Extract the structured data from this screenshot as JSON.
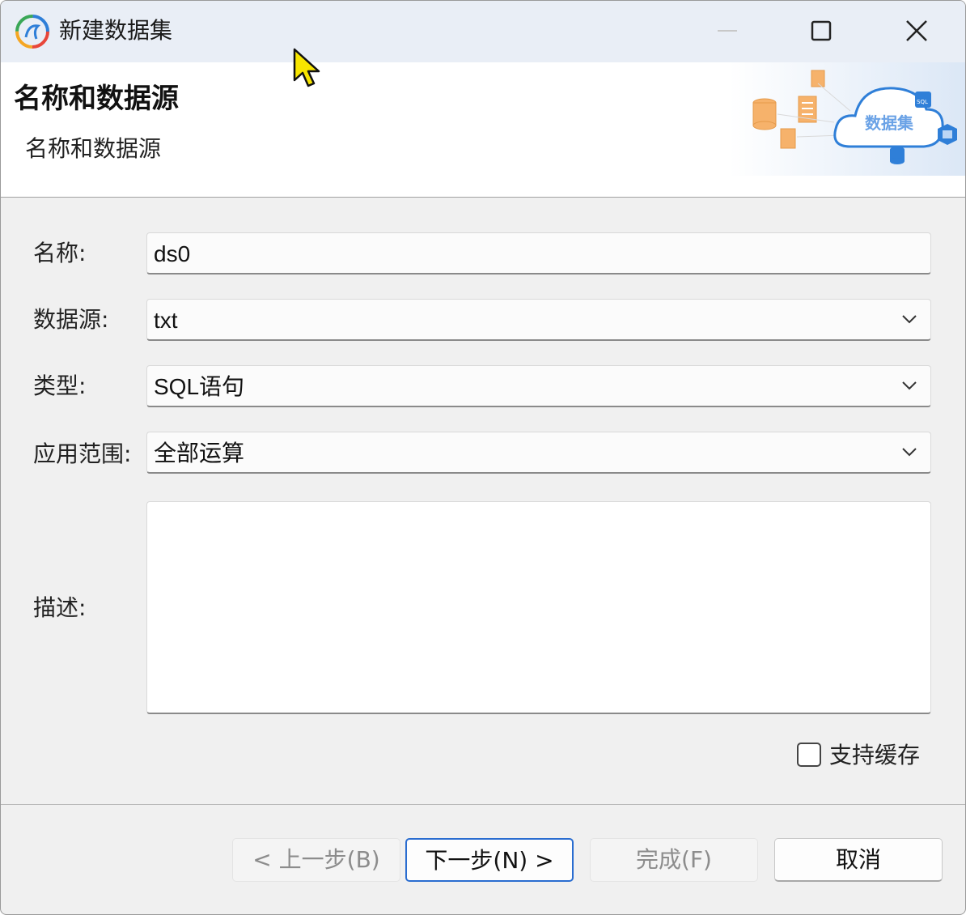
{
  "window": {
    "title": "新建数据集",
    "icon": "app-logo-icon",
    "controls": [
      "minimize-icon",
      "maximize-icon",
      "close-icon"
    ]
  },
  "banner": {
    "title": "名称和数据源",
    "subtitle": "名称和数据源",
    "graphic_text": "数据集",
    "graphic_tag": "SQL"
  },
  "form": {
    "name_label": "名称:",
    "name_value": "ds0",
    "datasource_label": "数据源:",
    "datasource_value": "txt",
    "type_label": "类型:",
    "type_value": "SQL语句",
    "scope_label": "应用范围:",
    "scope_value": "全部运算",
    "description_label": "描述:",
    "description_value": "",
    "cache_label": "支持缓存",
    "cache_checked": false
  },
  "buttons": {
    "back": "< 上一步(B)",
    "next": "下一步(N) >",
    "finish": "完成(F)",
    "cancel": "取消"
  },
  "colors": {
    "accent": "#2a6dd0",
    "titlebar": "#e9eef6",
    "background": "#f0f0f0"
  }
}
